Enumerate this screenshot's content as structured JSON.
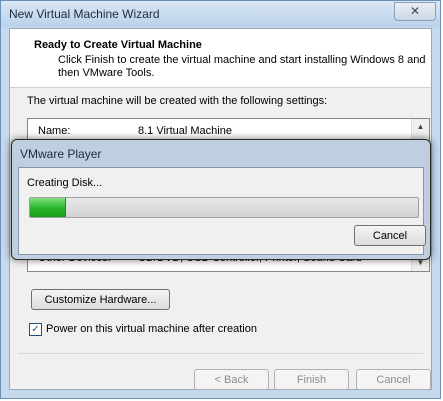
{
  "window": {
    "title": "New Virtual Machine Wizard",
    "close_glyph": "✕"
  },
  "header": {
    "title": "Ready to Create Virtual Machine",
    "description": "Click Finish to create the virtual machine and start installing Windows 8 and then VMware Tools."
  },
  "intro_text": "The virtual machine will be created with the following settings:",
  "settings": [
    {
      "key": "Name:",
      "value": "8.1 Virtual Machine"
    },
    {
      "key": "Other Devices:",
      "value": "CD/DVD, USB Controller, Printer, Sound Card"
    }
  ],
  "customize_label": "Customize Hardware...",
  "power_on": {
    "label": "Power on this virtual machine after creation",
    "checked": true,
    "glyph": "✓"
  },
  "footer": {
    "back": "< Back",
    "finish": "Finish",
    "cancel": "Cancel"
  },
  "progress_dialog": {
    "title": "VMware Player",
    "status": "Creating Disk...",
    "progress_percent": 9,
    "cancel": "Cancel",
    "progress_color": "#27b527"
  }
}
